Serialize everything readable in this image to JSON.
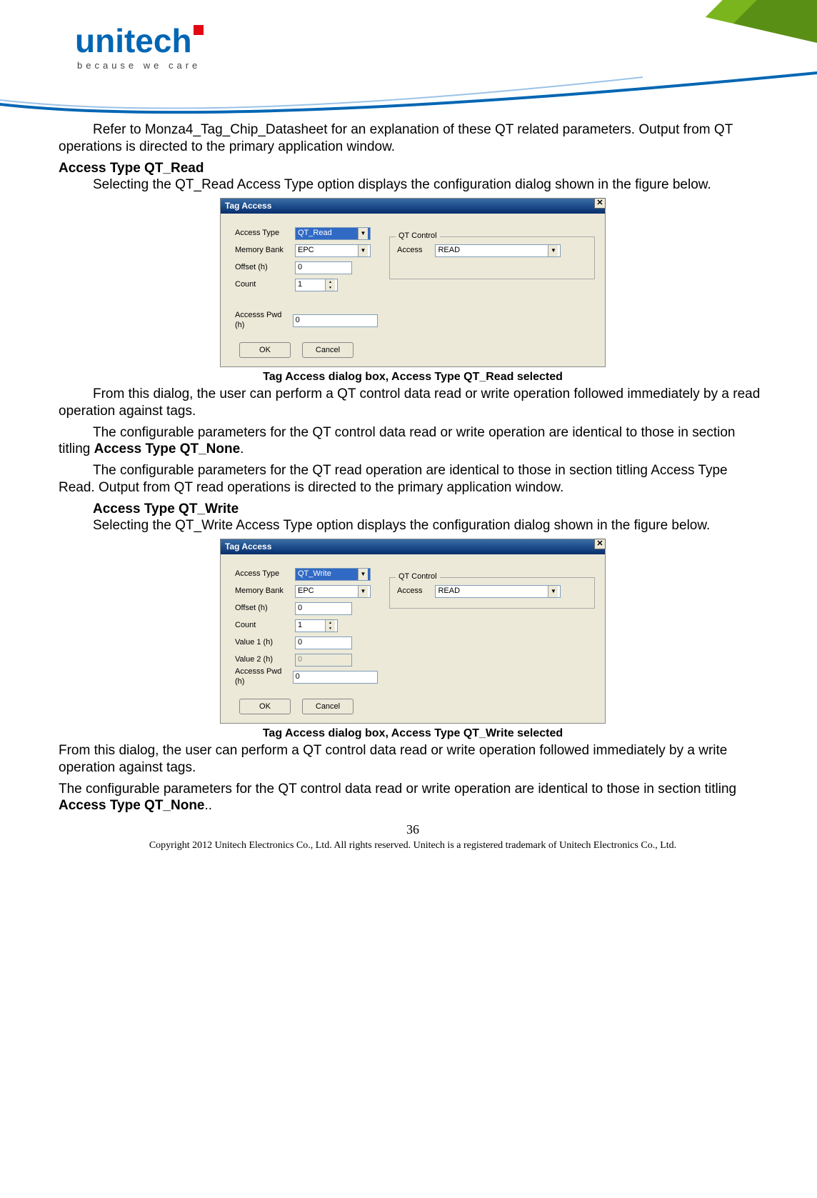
{
  "logo": {
    "brand": "unitech",
    "tagline": "because we care"
  },
  "body": {
    "p1": "Refer to Monza4_Tag_Chip_Datasheet for an explanation of these QT related parameters. Output from QT operations is directed to the primary application window.",
    "h1": "Access Type QT_Read",
    "p2": "Selecting the QT_Read Access Type option displays the configuration dialog shown in the figure below.",
    "cap1": "Tag Access dialog box, Access Type QT_Read selected",
    "p3": "From this dialog, the user can perform a QT control data read or write operation followed immediately by a read operation against tags.",
    "p4a": "The configurable parameters for the QT control data read or write operation are identical to those in section titling ",
    "p4b": "Access Type QT_None",
    "p4c": ".",
    "p5": "The configurable parameters for the QT read operation are identical to those in section titling Access Type Read. Output from QT read operations is directed to the primary application window.",
    "h2": "Access Type QT_Write",
    "p6": "Selecting the QT_Write Access Type option displays the configuration dialog shown in the figure below.",
    "cap2": "Tag Access dialog box, Access Type QT_Write selected",
    "p7": "From this dialog, the user can perform a QT control data read or write operation followed immediately by a write operation against tags.",
    "p8a": "The configurable parameters for the QT control data read or write operation are identical to those in section titling ",
    "p8b": "Access Type QT_None",
    "p8c": ".."
  },
  "dialog1": {
    "title": "Tag Access",
    "access_type_label": "Access Type",
    "access_type_value": "QT_Read",
    "memory_bank_label": "Memory Bank",
    "memory_bank_value": "EPC",
    "offset_label": "Offset (h)",
    "offset_value": "0",
    "count_label": "Count",
    "count_value": "1",
    "access_pwd_label": "Accesss Pwd (h)",
    "access_pwd_value": "0",
    "qt_control_legend": "QT Control",
    "qt_access_label": "Access",
    "qt_access_value": "READ",
    "ok": "OK",
    "cancel": "Cancel"
  },
  "dialog2": {
    "title": "Tag Access",
    "access_type_label": "Access Type",
    "access_type_value": "QT_Write",
    "memory_bank_label": "Memory Bank",
    "memory_bank_value": "EPC",
    "offset_label": "Offset (h)",
    "offset_value": "0",
    "count_label": "Count",
    "count_value": "1",
    "value1_label": "Value 1 (h)",
    "value1_value": "0",
    "value2_label": "Value 2 (h)",
    "value2_value": "0",
    "access_pwd_label": "Accesss Pwd (h)",
    "access_pwd_value": "0",
    "qt_control_legend": "QT Control",
    "qt_access_label": "Access",
    "qt_access_value": "READ",
    "ok": "OK",
    "cancel": "Cancel"
  },
  "footer": {
    "page": "36",
    "copyright": "Copyright 2012 Unitech Electronics Co., Ltd. All rights reserved. Unitech is a registered trademark of Unitech Electronics Co., Ltd."
  }
}
